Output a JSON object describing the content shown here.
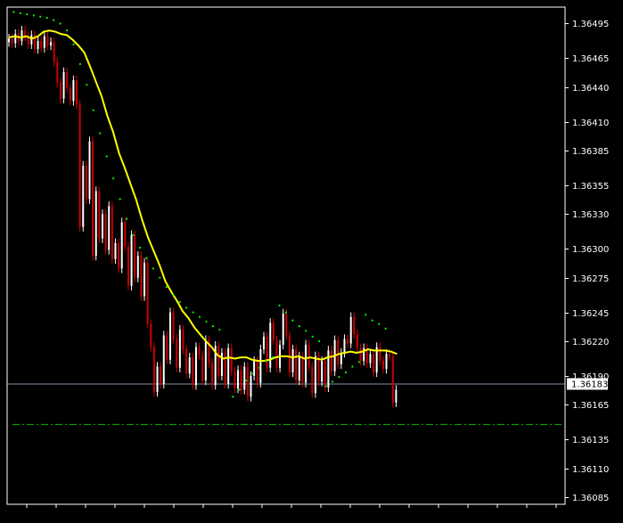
{
  "chart_data": {
    "type": "candlestick",
    "title": "",
    "xlabel": "",
    "ylabel": "",
    "ylim": [
      1.36075,
      1.36505
    ],
    "y_ticks": [
      "1.36495",
      "1.36465",
      "1.36440",
      "1.36410",
      "1.36385",
      "1.36355",
      "1.36330",
      "1.36300",
      "1.36275",
      "1.36245",
      "1.36220",
      "1.36190",
      "1.36165",
      "1.36135",
      "1.36110",
      "1.36085"
    ],
    "current_price": "1.36183",
    "dashed_level": 1.36148,
    "grid": false,
    "colors": {
      "background": "#000000",
      "axis": "#ffffff",
      "bull_candle": "#ffffff",
      "bear_candle": "#cc0000",
      "moving_average": "#ffff00",
      "parabolic_sar": "#00ff00",
      "dashed_level": "#00bb00",
      "current_price_line": "#8090a8"
    },
    "series": [
      {
        "type": "ohlc",
        "close": [
          1.36482,
          1.36478,
          1.36486,
          1.3648,
          1.36489,
          1.36484,
          1.36477,
          1.36485,
          1.36473,
          1.3648,
          1.36474,
          1.36484,
          1.36476,
          1.36479,
          1.36462,
          1.36444,
          1.3643,
          1.36453,
          1.36439,
          1.36428,
          1.36446,
          1.36425,
          1.36319,
          1.36372,
          1.36343,
          1.36393,
          1.36294,
          1.3635,
          1.36309,
          1.3633,
          1.36299,
          1.36337,
          1.36291,
          1.36305,
          1.36283,
          1.36323,
          1.36302,
          1.36268,
          1.36312,
          1.36275,
          1.36294,
          1.36259,
          1.36288,
          1.36235,
          1.36215,
          1.36176,
          1.36198,
          1.36183,
          1.36225,
          1.36204,
          1.36245,
          1.36222,
          1.36197,
          1.3623,
          1.36213,
          1.36192,
          1.36206,
          1.36182,
          1.36215,
          1.36208,
          1.36186,
          1.36221,
          1.36201,
          1.36182,
          1.36216,
          1.3619,
          1.3621,
          1.36183,
          1.36214,
          1.36194,
          1.36179,
          1.36195,
          1.36178,
          1.36198,
          1.36172,
          1.3619,
          1.36203,
          1.36184,
          1.36213,
          1.36224,
          1.36197,
          1.36236,
          1.36221,
          1.36197,
          1.36217,
          1.36244,
          1.36225,
          1.36193,
          1.36213,
          1.36186,
          1.36207,
          1.36184,
          1.36217,
          1.36198,
          1.36175,
          1.36207,
          1.36185,
          1.36203,
          1.3618,
          1.36212,
          1.36194,
          1.36221,
          1.362,
          1.3621,
          1.36222,
          1.36218,
          1.36241,
          1.36226,
          1.36214,
          1.36203,
          1.36214,
          1.36201,
          1.36209,
          1.36193,
          1.36215,
          1.36203,
          1.36196,
          1.36209,
          1.36207,
          1.36167,
          1.36178
        ]
      },
      {
        "name": "",
        "type": "line",
        "values": [
          1.36483,
          1.36484,
          1.36483,
          1.36484,
          1.36482,
          1.36484,
          1.36488,
          1.36489,
          1.36488,
          1.36486,
          1.36485,
          1.36481,
          1.36476,
          1.3647,
          1.36458,
          1.36445,
          1.36432,
          1.36415,
          1.36401,
          1.36383,
          1.3637,
          1.36356,
          1.36342,
          1.36325,
          1.3631,
          1.36298,
          1.36286,
          1.36272,
          1.36263,
          1.36255,
          1.36246,
          1.3624,
          1.36232,
          1.36226,
          1.3622,
          1.36215,
          1.36208,
          1.36205,
          1.36206,
          1.36205,
          1.36206,
          1.36206,
          1.36204,
          1.36203,
          1.36203,
          1.36204,
          1.36206,
          1.36207,
          1.36207,
          1.36206,
          1.36207,
          1.36205,
          1.36206,
          1.36205,
          1.36204,
          1.36206,
          1.36207,
          1.36209,
          1.3621,
          1.36211,
          1.3621,
          1.36211,
          1.36213,
          1.36212,
          1.36212,
          1.36212,
          1.36211,
          1.36209
        ]
      },
      {
        "name": "",
        "type": "dots",
        "points": [
          [
            1,
            1.36505
          ],
          [
            2,
            1.36504
          ],
          [
            3,
            1.36503
          ],
          [
            4,
            1.36502
          ],
          [
            5,
            1.36501
          ],
          [
            6,
            1.365
          ],
          [
            7,
            1.36498
          ],
          [
            8,
            1.36495
          ],
          [
            9,
            1.36489
          ],
          [
            10,
            1.36477
          ],
          [
            11,
            1.3646
          ],
          [
            12,
            1.36442
          ],
          [
            13,
            1.3642
          ],
          [
            14,
            1.364
          ],
          [
            15,
            1.3638
          ],
          [
            16,
            1.36361
          ],
          [
            17,
            1.36343
          ],
          [
            18,
            1.36326
          ],
          [
            19,
            1.36312
          ],
          [
            20,
            1.36301
          ],
          [
            21,
            1.36292
          ],
          [
            22,
            1.36283
          ],
          [
            23,
            1.36275
          ],
          [
            24,
            1.36267
          ],
          [
            25,
            1.3626
          ],
          [
            26,
            1.36254
          ],
          [
            27,
            1.36249
          ],
          [
            28,
            1.36245
          ],
          [
            29,
            1.36241
          ],
          [
            30,
            1.36237
          ],
          [
            31,
            1.36233
          ],
          [
            32,
            1.3623
          ],
          [
            34,
            1.36172
          ],
          [
            35,
            1.36178
          ],
          [
            36,
            1.36186
          ],
          [
            37,
            1.36192
          ],
          [
            38,
            1.36197
          ],
          [
            39,
            1.36203
          ],
          [
            40,
            1.36206
          ],
          [
            41,
            1.36251
          ],
          [
            42,
            1.36245
          ],
          [
            43,
            1.36238
          ],
          [
            44,
            1.36233
          ],
          [
            45,
            1.36229
          ],
          [
            46,
            1.36224
          ],
          [
            47,
            1.3622
          ],
          [
            48,
            1.36181
          ],
          [
            49,
            1.36185
          ],
          [
            50,
            1.36189
          ],
          [
            51,
            1.36193
          ],
          [
            52,
            1.36198
          ],
          [
            53,
            1.36202
          ],
          [
            54,
            1.36243
          ],
          [
            55,
            1.36238
          ],
          [
            56,
            1.36235
          ],
          [
            57,
            1.36231
          ]
        ]
      }
    ]
  }
}
